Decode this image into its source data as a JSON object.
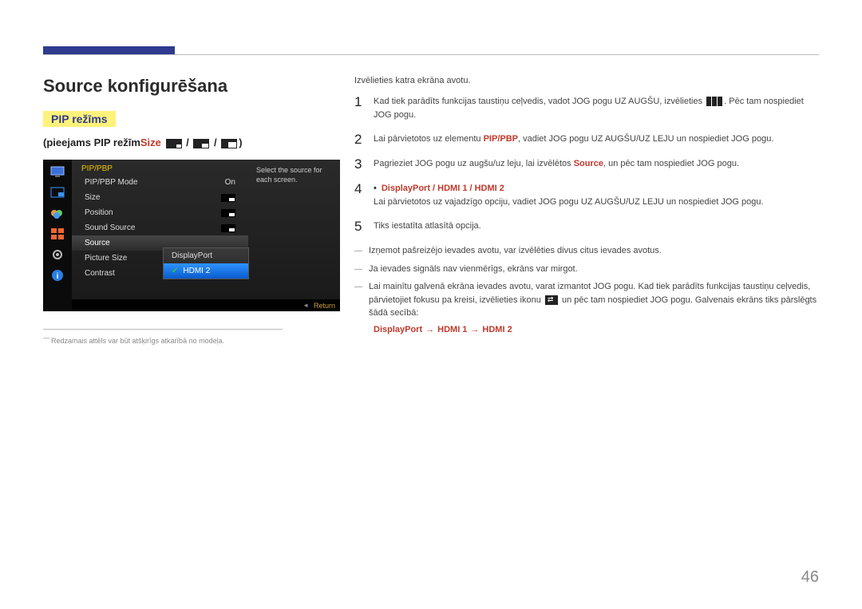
{
  "page_number": "46",
  "title": "Source konfigurēšana",
  "pip_mode_label": "PIP režīms",
  "subheading_prefix": "(pieejams PIP režīm",
  "subheading_size_word": "Size",
  "subheading_suffix": ")",
  "sep_slash": " / ",
  "osd": {
    "menu_title": "PIP/PBP",
    "help_text": "Select the source for each screen.",
    "items": [
      {
        "label": "PIP/PBP Mode",
        "value": "On"
      },
      {
        "label": "Size",
        "value_icon": true
      },
      {
        "label": "Position",
        "value_icon": true
      },
      {
        "label": "Sound Source",
        "value_icon": true
      },
      {
        "label": "Source",
        "highlight": true
      },
      {
        "label": "Picture Size"
      },
      {
        "label": "Contrast"
      }
    ],
    "dropdown": [
      "DisplayPort",
      "HDMI 2"
    ],
    "dropdown_selected": "HDMI 2",
    "return_label": "Return"
  },
  "footnote": "Redzamais attēls var būt atšķirīgs atkarībā no modeļa.",
  "right": {
    "lead": "Izvēlieties katra ekrāna avotu.",
    "steps": {
      "s1a": "Kad tiek parādīts funkcijas taustiņu ceļvedis, vadot JOG pogu UZ AUGŠU, izvēlieties ",
      "s1b": ". Pēc tam nospiediet JOG pogu.",
      "s2a": "Lai pārvietotos uz elementu ",
      "s2_pip": "PIP/PBP",
      "s2b": ", vadiet JOG pogu UZ AUGŠU/UZ LEJU un nospiediet JOG pogu.",
      "s3a": "Pagrieziet JOG pogu uz augšu/uz leju, lai izvēlētos ",
      "s3_source": "Source",
      "s3b": ", un pēc tam nospiediet JOG pogu.",
      "s4_opts": "DisplayPort / HDMI 1 / HDMI 2",
      "s4": "Lai pārvietotos uz vajadzīgo opciju, vadiet JOG pogu UZ AUGŠU/UZ LEJU un nospiediet JOG pogu.",
      "s5": "Tiks iestatīta atlasītā opcija."
    },
    "notes": {
      "n1": "Izņemot pašreizējo ievades avotu, var izvēlēties divus citus ievades avotus.",
      "n2": "Ja ievades signāls nav vienmērīgs, ekrāns var mirgot.",
      "n3a": "Lai mainītu galvenā ekrāna ievades avotu, varat izmantot JOG pogu. Kad tiek parādīts funkcijas taustiņu ceļvedis, pārvietojiet fokusu pa kreisi, izvēlieties ikonu ",
      "n3b": " un pēc tam nospiediet JOG pogu. Galvenais ekrāns tiks pārslēgts šādā secībā:",
      "cycle_dp": "DisplayPort",
      "cycle_h1": "HDMI 1",
      "cycle_h2": "HDMI 2"
    }
  }
}
